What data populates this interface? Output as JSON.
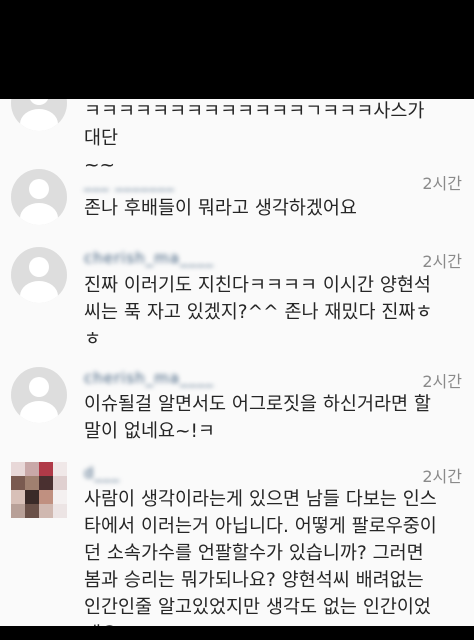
{
  "comments": [
    {
      "username": "",
      "time": "",
      "text": "ㅋㅋㅋㅋㅋㅋㅋㅋㅋㅋㅋㅋㅋㄱㅋㅋㅋ사스가 대단\n~~"
    },
    {
      "username": "___ _______",
      "time": "2시간",
      "text": "존나 후배들이 뭐라고 생각하겠어요"
    },
    {
      "username": "cherish_ma____",
      "time": "2시간",
      "text": "진짜 이러기도 지친다ㅋㅋㅋㅋ 이시간 양현석\n씨는 푹 자고 있겠지?^^ 존나 재밌다 진짜ㅎ\nㅎ"
    },
    {
      "username": "cherish_ma____",
      "time": "2시간",
      "text": "이슈될걸 알면서도 어그로짓을 하신거라면 할\n말이 없네요~!ㅋ"
    },
    {
      "username": "d___",
      "time": "2시간",
      "text": "사람이 생각이라는게 있으면 남들 다보는 인스\n타에서 이러는거 아닙니다. 어떻게 팔로우중이\n던 소속가수를 언팔할수가 있습니까? 그러면\n봄과 승리는 뭐가되나요? 양현석씨 배려없는\n인간인줄 알고있었지만 생각도 없는 인간이었\n네요"
    }
  ],
  "colors": {
    "background": "#fafafa",
    "text": "#262626",
    "username": "#3a5a7a",
    "time": "#8a8a8a",
    "avatar_placeholder": "#dddddd"
  },
  "avatar_photo_pixels": [
    "#e8d8d8",
    "#c9a8a8",
    "#b03a48",
    "#f0e8e8",
    "#7a5a50",
    "#a08070",
    "#4a3030",
    "#e0d0d0",
    "#d8c0b8",
    "#3a2a28",
    "#c09080",
    "#f4f0f0",
    "#b8a098",
    "#6a5048",
    "#d0b8b0",
    "#ece4e4"
  ]
}
